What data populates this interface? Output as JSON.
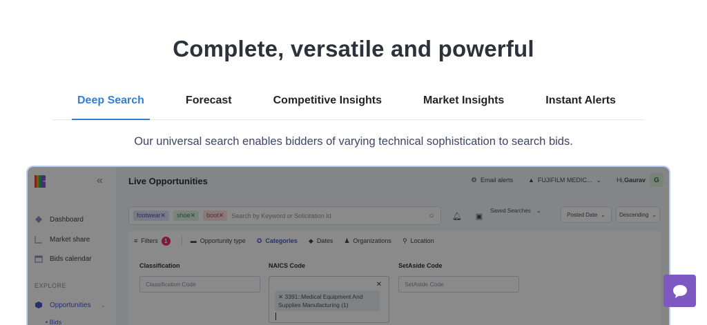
{
  "headline": "Complete, versatile and powerful",
  "tabs": [
    {
      "label": "Deep Search",
      "active": true
    },
    {
      "label": "Forecast",
      "active": false
    },
    {
      "label": "Competitive Insights",
      "active": false
    },
    {
      "label": "Market Insights",
      "active": false
    },
    {
      "label": "Instant Alerts",
      "active": false
    }
  ],
  "tagline": "Our universal search enables bidders of varying technical sophistication to search bids.",
  "app": {
    "sidebar": {
      "items": [
        {
          "label": "Dashboard",
          "icon": "dashboard-icon"
        },
        {
          "label": "Market share",
          "icon": "chart-icon"
        },
        {
          "label": "Bids calendar",
          "icon": "calendar-icon"
        }
      ],
      "section_label": "EXPLORE",
      "opportunities_label": "Opportunities",
      "bids_label": "• Bids"
    },
    "header": {
      "title": "Live Opportunities",
      "email_alerts": "Email alerts",
      "org": "FUJIFILM MEDIC...",
      "greeting": "Hi, ",
      "user": "Gaurav",
      "avatar_initial": "G"
    },
    "search": {
      "chips": [
        "footwear✕",
        "shoe✕",
        "boot✕"
      ],
      "placeholder": "Search by Keyword or Solicitation Id"
    },
    "saved_searches": "Saved Searches",
    "sort_field": "Posted Date",
    "sort_order": "Descending",
    "filter_tabs": {
      "filters": "Filters",
      "filter_count": "1",
      "opportunity_type": "Opportunity type",
      "categories": "Categories",
      "dates": "Dates",
      "organizations": "Organizations",
      "location": "Location"
    },
    "fields": {
      "classification_label": "Classification",
      "classification_placeholder": "Classification Code",
      "naics_label": "NAICS Code",
      "naics_selected": "✕ 3391::Medical Equipment And Supplies Manufacturing (1)",
      "setaside_label": "SetAside Code",
      "setaside_placeholder": "SetAside Code"
    }
  },
  "colors": {
    "accent": "#2f7fd6",
    "chat": "#7d57c2",
    "badge": "#e3375f"
  }
}
